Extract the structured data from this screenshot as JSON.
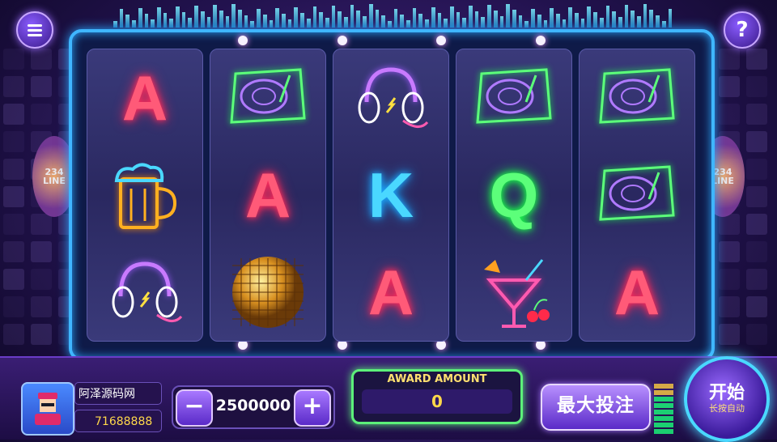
{
  "top_buttons": {
    "menu_icon": "menu-icon",
    "help_icon": "help-icon",
    "help_label": "?"
  },
  "paylines": {
    "count": "234",
    "unit": "LINE"
  },
  "reels": [
    [
      "A",
      "beer-mug-icon",
      "headphones-icon"
    ],
    [
      "turntable-icon",
      "A",
      "disco-ball-icon"
    ],
    [
      "headphones-icon",
      "K",
      "A"
    ],
    [
      "turntable-icon",
      "Q",
      "cocktail-icon"
    ],
    [
      "turntable-icon",
      "turntable-icon",
      "A"
    ]
  ],
  "player": {
    "name": "阿泽源码网",
    "coins": "71688888",
    "avatar_icon": "avatar-icon"
  },
  "bet": {
    "minus_label": "−",
    "value": "2500000",
    "plus_label": "+"
  },
  "award": {
    "title": "AWARD AMOUNT",
    "value": "0"
  },
  "max_bet_label": "最大投注",
  "spin": {
    "label": "开始",
    "sub_label": "长按自动"
  },
  "colors": {
    "frame": "#3fb6ff",
    "award_border": "#5cf07a",
    "letter_A": "#ff5a78",
    "letter_K": "#4ad8ff",
    "letter_Q": "#5cff7a"
  }
}
